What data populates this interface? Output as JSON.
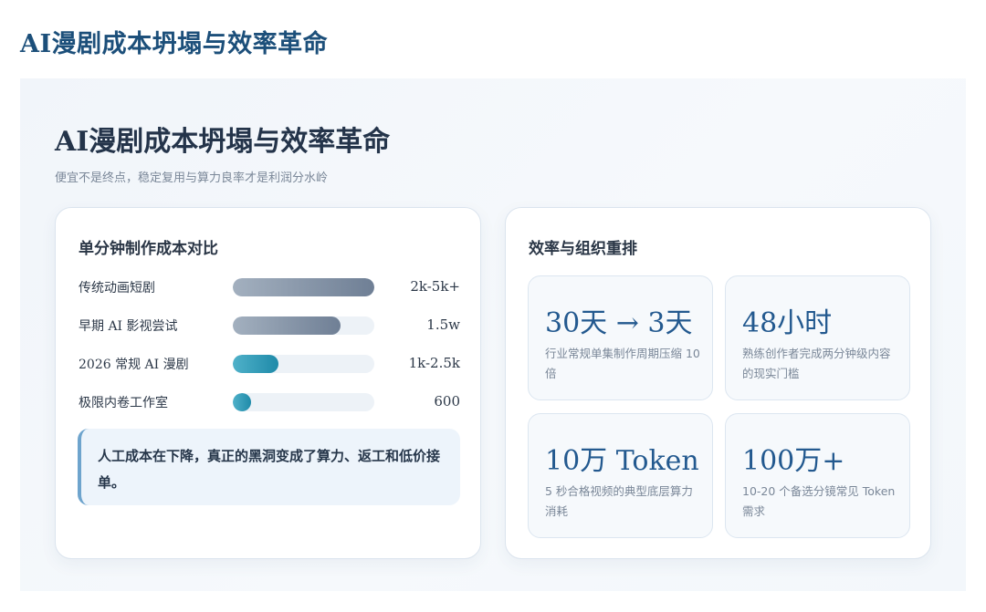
{
  "page": {
    "title": "AI漫剧成本坍塌与效率革命"
  },
  "slide": {
    "title": "AI漫剧成本坍塌与效率革命",
    "subtitle": "便宜不是终点，稳定复用与算力良率才是利润分水岭"
  },
  "cost_card": {
    "heading": "单分钟制作成本对比",
    "rows": [
      {
        "label": "传统动画短剧",
        "value": "2k-5k+",
        "fill_fraction": 1.0,
        "style": "gray"
      },
      {
        "label": "早期 AI 影视尝试",
        "value": "1.5w",
        "fill_fraction": 0.76,
        "style": "gray"
      },
      {
        "label": "2026 常规 AI 漫剧",
        "value": "1k-2.5k",
        "fill_fraction": 0.32,
        "style": "teal"
      },
      {
        "label": "极限内卷工作室",
        "value": "600",
        "fill_fraction": 0.13,
        "style": "teal"
      }
    ],
    "callout": "人工成本在下降，真正的黑洞变成了算力、返工和低价接单。"
  },
  "efficiency_card": {
    "heading": "效率与组织重排",
    "stats": [
      {
        "value": "30天 → 3天",
        "desc": "行业常规单集制作周期压缩 10 倍"
      },
      {
        "value": "48小时",
        "desc": "熟练创作者完成两分钟级内容的现实门槛"
      },
      {
        "value": "10万 Token",
        "desc": "5 秒合格视频的典型底层算力消耗"
      },
      {
        "value": "100万+",
        "desc": "10-20 个备选分镜常见 Token 需求"
      }
    ]
  },
  "colors": {
    "title": "#1c4f7a",
    "stat_value": "#23598f",
    "bar_gray": "#6f7f95",
    "bar_teal": "#1f8aa9",
    "callout_accent": "#6ea4cd"
  }
}
